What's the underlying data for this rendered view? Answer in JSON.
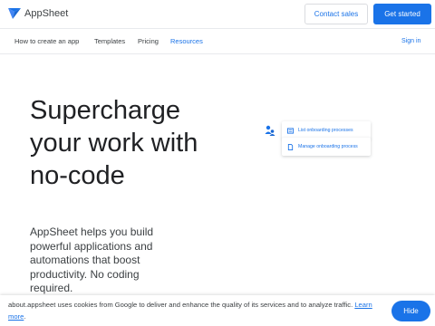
{
  "header": {
    "logo_text": "AppSheet",
    "contact_label": "Contact sales",
    "start_label": "Get started"
  },
  "nav": {
    "items": [
      {
        "label": "How to create an app"
      },
      {
        "label": "Templates"
      },
      {
        "label": "Pricing"
      },
      {
        "label": "Resources",
        "active": true
      }
    ],
    "signin_label": "Sign in"
  },
  "hero": {
    "title": "Supercharge your work with no-code",
    "description": "AppSheet helps you build powerful applications and automations that boost productivity. No coding required."
  },
  "illustration": {
    "chips": [
      {
        "label": "List onboarding processes",
        "icon": "list-icon"
      },
      {
        "label": "Manage onboarding process",
        "icon": "document-icon"
      }
    ]
  },
  "cookie": {
    "text": "about.appsheet uses cookies from Google to deliver and enhance the quality of its services and to analyze traffic.",
    "link_label": "Learn more",
    "after_link": ".",
    "hide_label": "Hide"
  },
  "colors": {
    "accent": "#1a73e8",
    "text": "#202124",
    "muted": "#3c4043"
  }
}
